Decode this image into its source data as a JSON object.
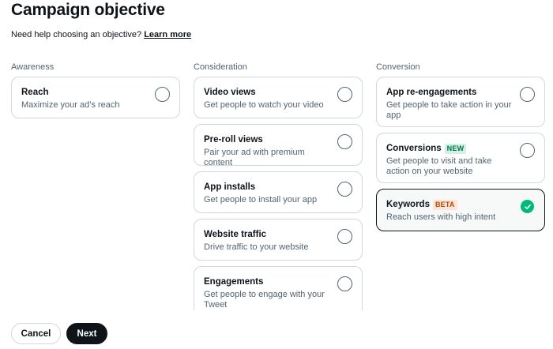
{
  "header": {
    "title": "Campaign objective",
    "help_text": "Need help choosing an objective?",
    "help_link": "Learn more"
  },
  "columns": {
    "awareness": {
      "heading": "Awareness",
      "options": [
        {
          "title": "Reach",
          "desc": "Maximize your ad’s reach",
          "selected": false
        }
      ]
    },
    "consideration": {
      "heading": "Consideration",
      "options": [
        {
          "title": "Video views",
          "desc": "Get people to watch your video",
          "selected": false
        },
        {
          "title": "Pre-roll views",
          "desc": "Pair your ad with premium content",
          "selected": false
        },
        {
          "title": "App installs",
          "desc": "Get people to install your app",
          "selected": false
        },
        {
          "title": "Website traffic",
          "desc": "Drive traffic to your website",
          "selected": false
        },
        {
          "title": "Engagements",
          "desc": "Get people to engage with your Tweet",
          "selected": false
        }
      ]
    },
    "conversion": {
      "heading": "Conversion",
      "options": [
        {
          "title": "App re-engagements",
          "desc": "Get people to take action in your app",
          "selected": false
        },
        {
          "title": "Conversions",
          "badge": "NEW",
          "desc": "Get people to visit and take action on your website",
          "selected": false
        },
        {
          "title": "Keywords",
          "badge": "BETA",
          "desc": "Reach users with high intent",
          "selected": true
        }
      ]
    }
  },
  "footer": {
    "cancel_label": "Cancel",
    "next_label": "Next"
  },
  "colors": {
    "selected_check": "#00ba7c",
    "new_badge_bg": "#d1f1e4",
    "beta_badge_bg": "#ffe5d9",
    "primary_button": "#0f1419"
  },
  "icons": {
    "radio_unchecked": "radio-empty-icon",
    "radio_checked": "checkmark-circle-icon"
  }
}
